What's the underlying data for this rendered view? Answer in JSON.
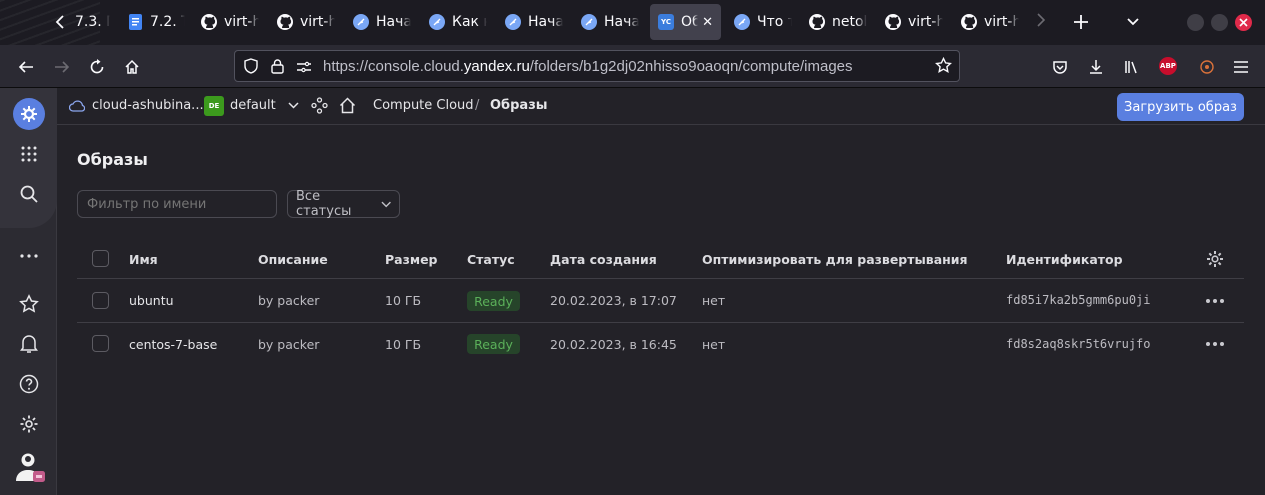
{
  "browser": {
    "tabs": [
      {
        "label": "7.3. Г",
        "icon": "back-chevron-icon"
      },
      {
        "label": "7.2. Т",
        "icon": "docs-icon"
      },
      {
        "label": "virt-h",
        "icon": "github-icon"
      },
      {
        "label": "virt-h",
        "icon": "github-icon"
      },
      {
        "label": "Нача",
        "icon": "feather-icon"
      },
      {
        "label": "Как н",
        "icon": "feather-icon"
      },
      {
        "label": "Нача",
        "icon": "feather-icon"
      },
      {
        "label": "Нача",
        "icon": "feather-icon"
      },
      {
        "label": "Об",
        "icon": "yc-icon"
      },
      {
        "label": "Что т",
        "icon": "feather-icon"
      },
      {
        "label": "netol",
        "icon": "github-icon"
      },
      {
        "label": "virt-h",
        "icon": "github-icon"
      },
      {
        "label": "virt-h",
        "icon": "github-icon"
      }
    ],
    "url_prefix": "https://console.cloud.",
    "url_domain": "yandex.ru",
    "url_path": "/folders/b1g2dj02nhisso9oaoqn/compute/images",
    "abp_label": "ABP"
  },
  "header": {
    "cloud_name": "cloud-ashubina...",
    "folder_badge": "DE",
    "folder_name": "default",
    "service": "Compute Cloud",
    "separator": "/",
    "page": "Образы",
    "upload_button": "Загрузить образ"
  },
  "main": {
    "title": "Образы",
    "filter_placeholder": "Фильтр по имени",
    "status_select": "Все статусы",
    "columns": [
      "Имя",
      "Описание",
      "Размер",
      "Статус",
      "Дата создания",
      "Оптимизировать для развертывания",
      "Идентификатор"
    ],
    "rows": [
      {
        "name": "ubuntu",
        "description": "by packer",
        "size": "10 ГБ",
        "status": "Ready",
        "created": "20.02.2023, в 17:07",
        "optimize": "нет",
        "id": "fd85i7ka2b5gmm6pu0ji"
      },
      {
        "name": "centos-7-base",
        "description": "by packer",
        "size": "10 ГБ",
        "status": "Ready",
        "created": "20.02.2023, в 16:45",
        "optimize": "нет",
        "id": "fd8s2aq8skr5t6vrujfo"
      }
    ]
  },
  "colors": {
    "accent": "#5a7fe0",
    "ready_text": "#5bb05a",
    "ready_bg": "#26442a",
    "folder_badge": "#3c9a1d"
  }
}
